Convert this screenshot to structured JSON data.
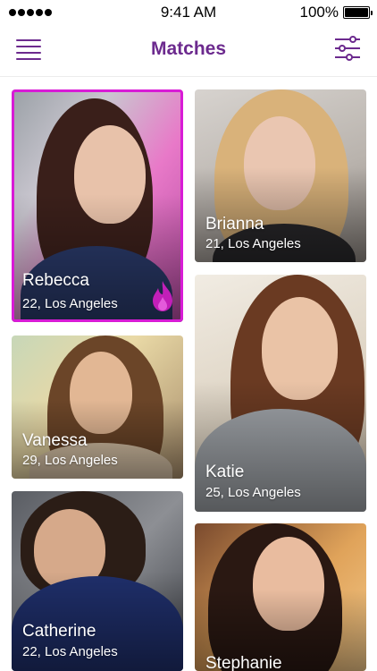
{
  "status_bar": {
    "time": "9:41 AM",
    "battery": "100%"
  },
  "header": {
    "title": "Matches",
    "menu_icon": "hamburger-menu-icon",
    "filter_icon": "sliders-filter-icon"
  },
  "accent_color": "#6c2a8e",
  "highlight_color": "#d81bd6",
  "matches": [
    {
      "name": "Rebecca",
      "details": "22, Los Angeles",
      "selected": true,
      "badge_icon": "flame-icon"
    },
    {
      "name": "Brianna",
      "details": "21, Los Angeles"
    },
    {
      "name": "Vanessa",
      "details": "29, Los Angeles"
    },
    {
      "name": "Katie",
      "details": "25, Los Angeles"
    },
    {
      "name": "Catherine",
      "details": "22, Los Angeles"
    },
    {
      "name": "Stephanie",
      "details": ""
    }
  ]
}
